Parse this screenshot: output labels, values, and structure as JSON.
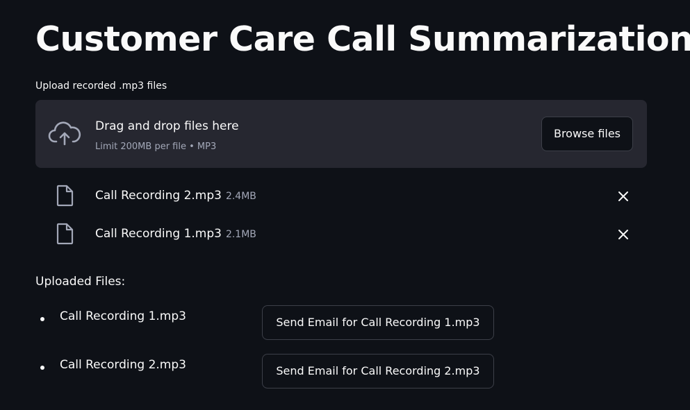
{
  "title": "Customer Care Call Summarization",
  "uploader": {
    "label": "Upload recorded .mp3 files",
    "drop_text": "Drag and drop files here",
    "limit_text": "Limit 200MB per file • MP3",
    "browse_label": "Browse files"
  },
  "files": [
    {
      "name": "Call Recording 2.mp3",
      "size": "2.4MB"
    },
    {
      "name": "Call Recording 1.mp3",
      "size": "2.1MB"
    }
  ],
  "uploaded": {
    "heading": "Uploaded Files:",
    "items": [
      {
        "name": "Call Recording 1.mp3",
        "button_label": "Send Email for Call Recording 1.mp3"
      },
      {
        "name": "Call Recording 2.mp3",
        "button_label": "Send Email for Call Recording 2.mp3"
      }
    ]
  },
  "colors": {
    "background": "#0e1117",
    "dropzone": "#262730",
    "text": "#fafafa",
    "muted_text": "#a3a8b8",
    "border": "#3d4049"
  },
  "icons": {
    "upload": "cloud-upload-icon",
    "file": "file-icon",
    "remove": "close-icon"
  }
}
